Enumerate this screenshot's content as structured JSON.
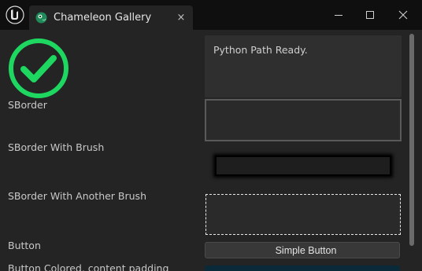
{
  "titlebar": {
    "tab_title": "Chameleon Gallery",
    "tab_close": "×",
    "logo_icon": "unreal-engine-logo-icon",
    "tab_icon": "chameleon-icon",
    "minimize_icon": "minimize-icon",
    "maximize_icon": "maximize-icon",
    "close_icon": "close-icon"
  },
  "main": {
    "status_icon": "check-circle-icon",
    "status_icon_color": "#1ed760",
    "python_status": "Python Path Ready.",
    "rows": [
      {
        "label": "SBorder"
      },
      {
        "label": "SBorder With Brush"
      },
      {
        "label": "SBorder With Another Brush"
      },
      {
        "label": "Button"
      },
      {
        "label": "Button Colored, content padding"
      }
    ],
    "simple_button_label": "Simple Button"
  },
  "colors": {
    "titlebar_bg": "#0f0f0f",
    "panel_bg": "#242424",
    "accent_green": "#1ed760",
    "colored_button_bg": "#0a2a3a"
  }
}
